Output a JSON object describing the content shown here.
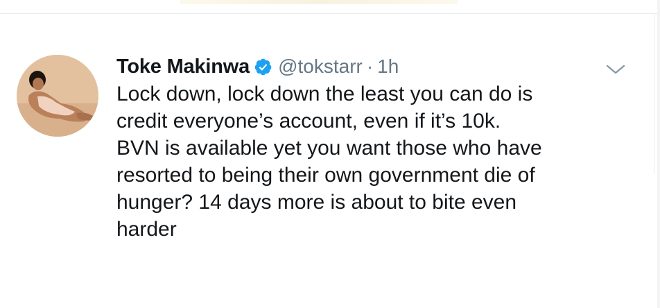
{
  "tweet": {
    "author": {
      "display_name": "Toke Makinwa",
      "handle": "@tokstarr",
      "verified": true
    },
    "separator": "·",
    "timestamp": "1h",
    "lines": [
      "Lock down, lock down the least you can do is",
      "credit everyone’s account, even if it’s 10k.",
      "BVN is available yet you want those who have",
      "resorted to being their own government die of",
      "hunger? 14 days more is about to bite even",
      "harder"
    ]
  },
  "icons": {
    "verified": "verified-badge-icon",
    "more": "chevron-down-icon"
  },
  "colors": {
    "verified_blue": "#1da1f2",
    "text_primary": "#14171a",
    "text_secondary": "#657786"
  }
}
